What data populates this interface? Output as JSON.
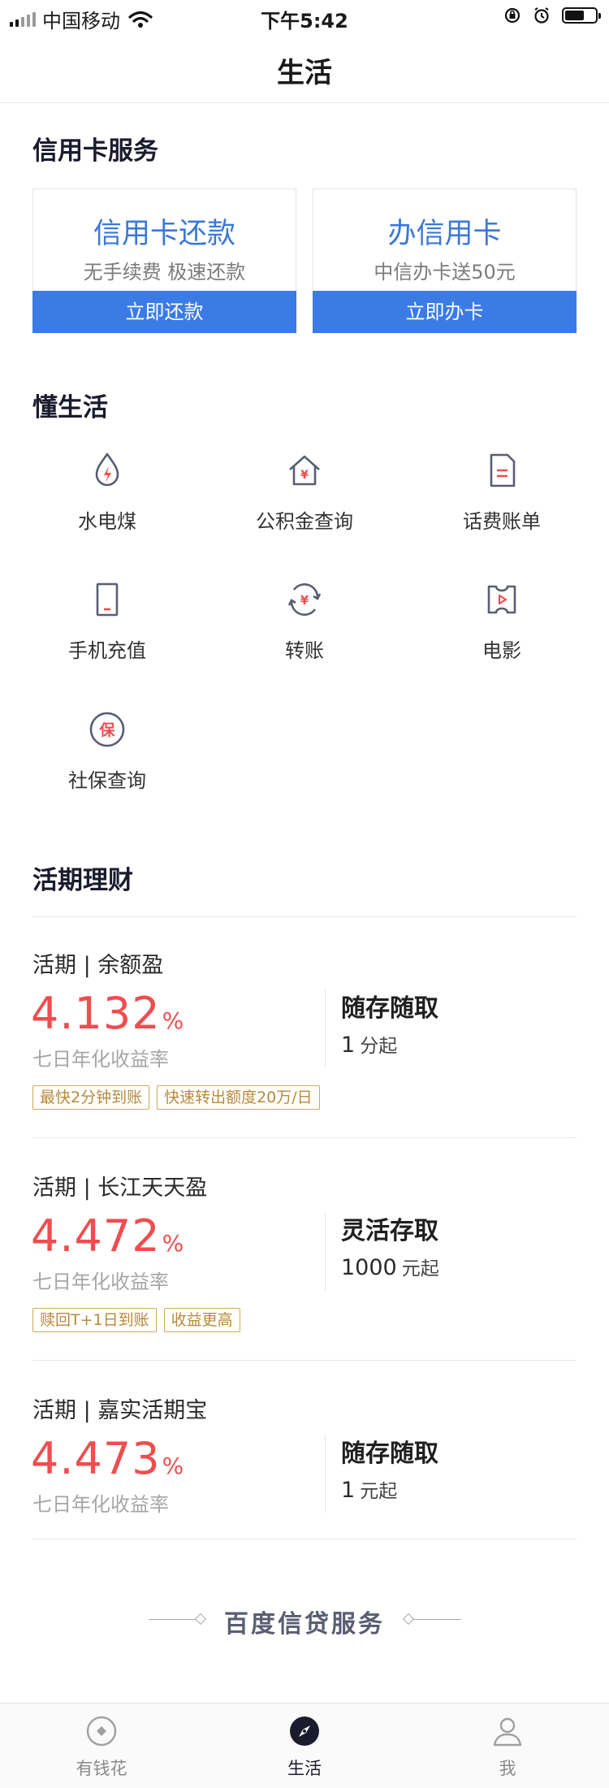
{
  "status_bar": {
    "carrier": "中国移动",
    "time": "下午5:42",
    "battery_level": 0.65
  },
  "nav": {
    "title": "生活"
  },
  "credit_section": {
    "title": "信用卡服务",
    "cards": [
      {
        "title": "信用卡还款",
        "subtitle": "无手续费 极速还款",
        "button": "立即还款"
      },
      {
        "title": "办信用卡",
        "subtitle": "中信办卡送50元",
        "button": "立即办卡"
      }
    ]
  },
  "life_section": {
    "title": "懂生活",
    "items": [
      {
        "label": "水电煤",
        "icon": "utility-drop-icon"
      },
      {
        "label": "公积金查询",
        "icon": "housing-fund-icon"
      },
      {
        "label": "话费账单",
        "icon": "phone-bill-icon"
      },
      {
        "label": "手机充值",
        "icon": "phone-recharge-icon"
      },
      {
        "label": "转账",
        "icon": "transfer-icon"
      },
      {
        "label": "电影",
        "icon": "movie-icon"
      },
      {
        "label": "社保查询",
        "icon": "social-security-icon"
      }
    ],
    "accent_color": "#ef4d50",
    "icon_color": "#5a5d72"
  },
  "finance_section": {
    "title": "活期理财",
    "funds": [
      {
        "name": "活期 | 余额盈",
        "rate": "4.132",
        "rate_unit": "%",
        "rate_label": "七日年化收益率",
        "feature": "随存随取",
        "min_amount": "1",
        "min_unit": "分起",
        "tags": [
          "最快2分钟到账",
          "快速转出额度20万/日"
        ]
      },
      {
        "name": "活期 | 长江天天盈",
        "rate": "4.472",
        "rate_unit": "%",
        "rate_label": "七日年化收益率",
        "feature": "灵活存取",
        "min_amount": "1000",
        "min_unit": "元起",
        "tags": [
          "赎回T+1日到账",
          "收益更高"
        ]
      },
      {
        "name": "活期 | 嘉实活期宝",
        "rate": "4.473",
        "rate_unit": "%",
        "rate_label": "七日年化收益率",
        "feature": "随存随取",
        "min_amount": "1",
        "min_unit": "元起",
        "tags": []
      }
    ]
  },
  "brand": {
    "text": "百度信贷服务"
  },
  "tab_bar": {
    "active": "生活",
    "tabs": [
      {
        "label": "有钱花",
        "icon": "coin-icon"
      },
      {
        "label": "生活",
        "icon": "compass-icon"
      },
      {
        "label": "我",
        "icon": "user-icon"
      }
    ]
  },
  "colors": {
    "primary_blue": "#3a7be6",
    "rate_red": "#ef4d50",
    "tag_gold": "#b7893c"
  }
}
